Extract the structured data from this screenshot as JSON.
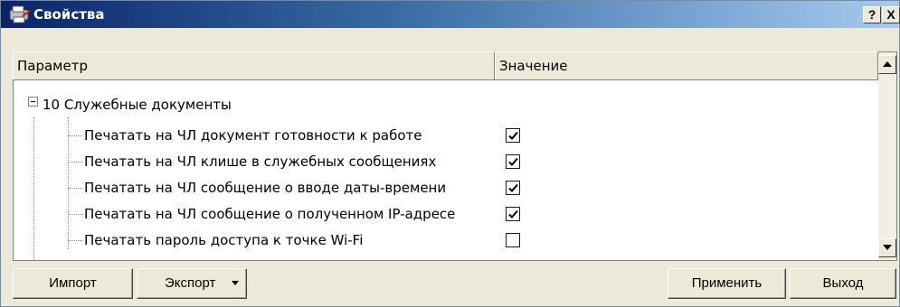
{
  "window": {
    "title": "Свойства",
    "help_button": "?",
    "close_button": "X"
  },
  "grid": {
    "columns": [
      "Параметр",
      "Значение"
    ],
    "group": {
      "label": "10 Служебные документы",
      "expanded": true
    },
    "items": [
      {
        "label": "Печатать на ЧЛ документ готовности к работе",
        "checked": true
      },
      {
        "label": "Печатать на ЧЛ клише в служебных сообщениях",
        "checked": true
      },
      {
        "label": "Печатать на ЧЛ сообщение о вводе даты-времени",
        "checked": true
      },
      {
        "label": "Печатать на ЧЛ сообщение о полученном IP-адресе",
        "checked": true
      },
      {
        "label": "Печатать пароль доступа к точке Wi-Fi",
        "checked": false
      }
    ]
  },
  "buttons": {
    "import": "Импорт",
    "export": "Экспорт",
    "apply": "Применить",
    "exit": "Выход"
  },
  "colors": {
    "titlebar_start": "#0a246a",
    "titlebar_end": "#a6caf0",
    "face": "#ece9d8"
  }
}
